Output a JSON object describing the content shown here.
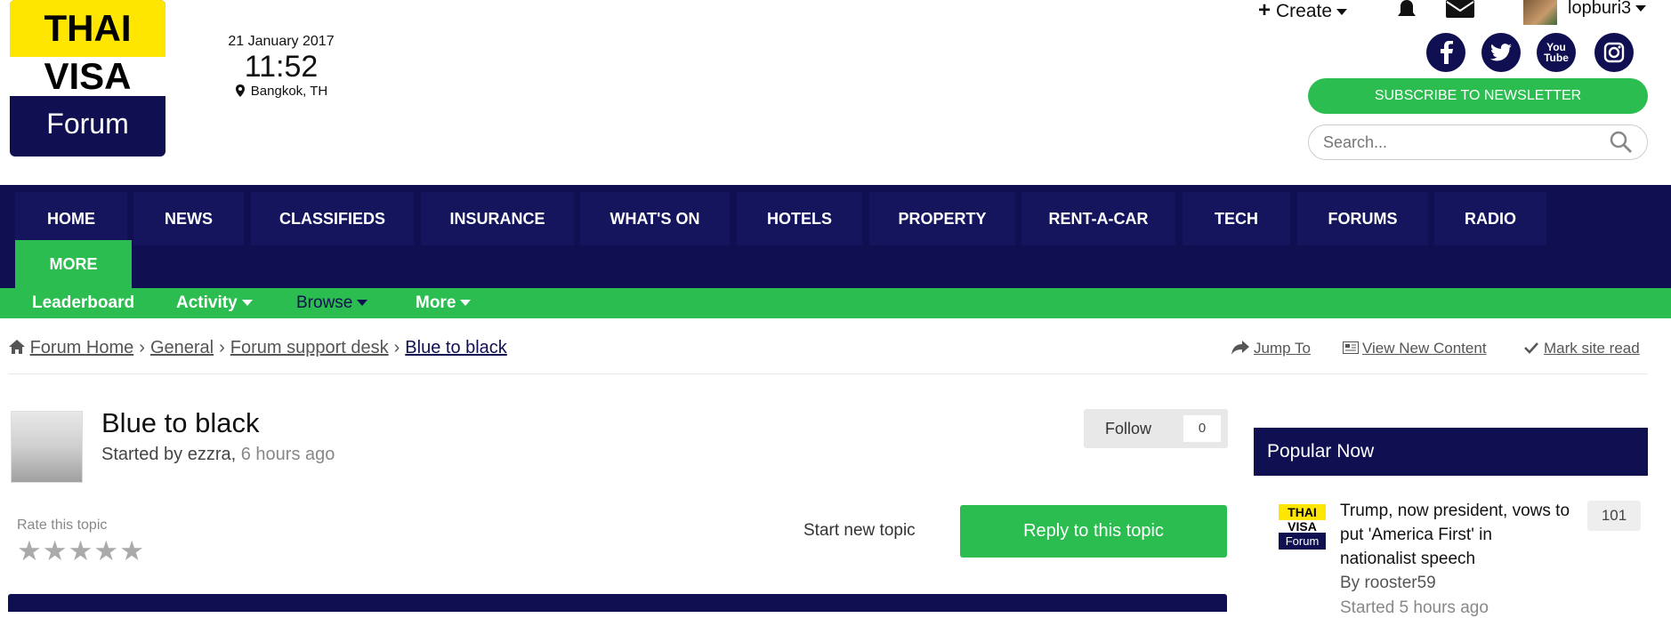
{
  "logo": {
    "line1": "THAI",
    "line2": "VISA",
    "line3": "Forum"
  },
  "clock": {
    "date": "21 January 2017",
    "time": "11:52",
    "location": "Bangkok, TH"
  },
  "user_bar": {
    "create_label": "Create",
    "username": "lopburi3"
  },
  "social": {
    "facebook": "f",
    "twitter": "t",
    "youtube": "You Tube",
    "instagram": "ig"
  },
  "newsletter_label": "SUBSCRIBE TO NEWSLETTER",
  "search": {
    "placeholder": "Search..."
  },
  "nav": {
    "items": [
      "HOME",
      "NEWS",
      "CLASSIFIEDS",
      "INSURANCE",
      "WHAT'S ON",
      "HOTELS",
      "PROPERTY",
      "RENT-A-CAR",
      "TECH",
      "FORUMS",
      "RADIO"
    ],
    "more": "MORE"
  },
  "subnav": {
    "leaderboard": "Leaderboard",
    "activity": "Activity",
    "browse": "Browse",
    "more": "More"
  },
  "breadcrumb": {
    "home": "Forum Home",
    "general": "General",
    "support": "Forum support desk",
    "current": "Blue to black"
  },
  "quick_links": {
    "jump": "Jump To",
    "new_content": "View New Content",
    "mark_read": "Mark site read"
  },
  "topic": {
    "title": "Blue to black",
    "started_prefix": "Started by ezzra,",
    "started_ago": "6 hours ago",
    "follow_label": "Follow",
    "follow_count": "0",
    "rate_label": "Rate this topic",
    "rating_stars": 0,
    "start_new": "Start new topic",
    "reply": "Reply to this topic"
  },
  "popular": {
    "heading": "Popular Now",
    "items": [
      {
        "logo_a": "THAI",
        "logo_b": "VISA",
        "logo_c": "Forum",
        "title": "Trump, now president, vows to put 'America First' in nationalist speech",
        "by": "By rooster59",
        "started": "Started 5 hours ago",
        "count": "101"
      }
    ]
  },
  "colors": {
    "navy": "#0f0f52",
    "green": "#2bbd4f",
    "yellow": "#ffe600"
  }
}
